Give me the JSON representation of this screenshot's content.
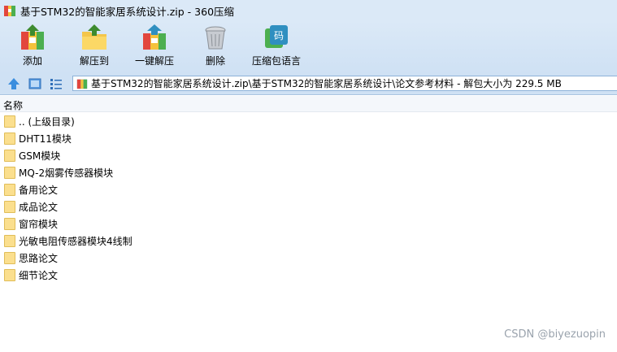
{
  "window": {
    "title": "基于STM32的智能家居系统设计.zip - 360压缩"
  },
  "toolbar": {
    "items": [
      {
        "label": "添加",
        "icon": "archive-add-icon"
      },
      {
        "label": "解压到",
        "icon": "folder-extract-icon"
      },
      {
        "label": "一键解压",
        "icon": "archive-extract-icon"
      },
      {
        "label": "删除",
        "icon": "trash-icon"
      },
      {
        "label": "压缩包语言",
        "icon": "archive-language-icon"
      }
    ]
  },
  "address": {
    "path": "基于STM32的智能家居系统设计.zip\\基于STM32的智能家居系统设计\\论文参考材料 - 解包大小为 229.5 MB"
  },
  "list": {
    "column_name": "名称",
    "items": [
      ".. (上级目录)",
      "DHT11模块",
      "GSM模块",
      "MQ-2烟雾传感器模块",
      "备用论文",
      "成品论文",
      "窗帘模块",
      "光敏电阻传感器模块4线制",
      "思路论文",
      "细节论文"
    ]
  },
  "watermark": "CSDN @biyezuopin"
}
